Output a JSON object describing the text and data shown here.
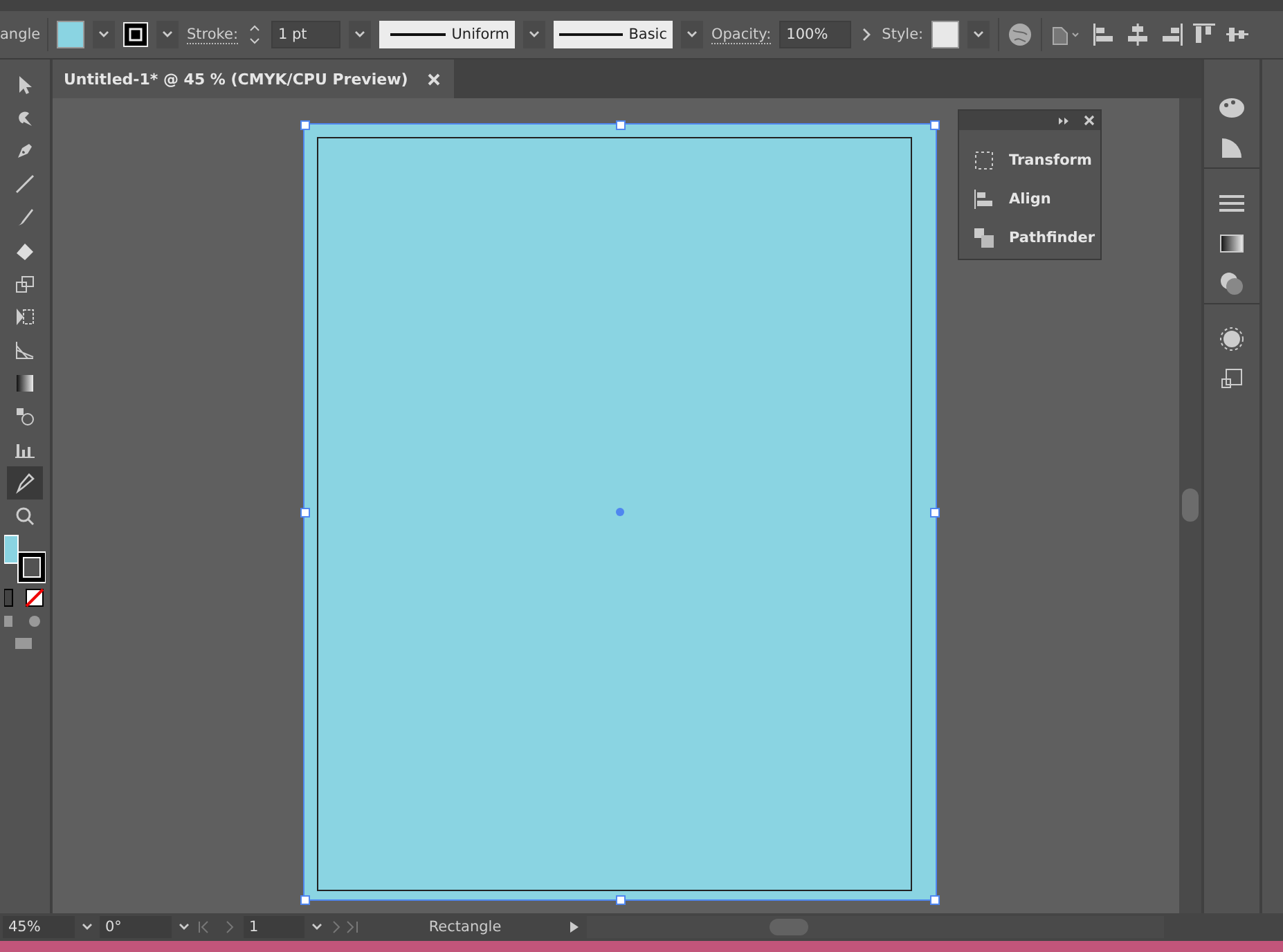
{
  "control_bar": {
    "tool_label": "angle",
    "stroke_label": "Stroke:",
    "stroke_weight": "1 pt",
    "profile": "Uniform",
    "brush": "Basic",
    "opacity_label": "Opacity:",
    "opacity": "100%",
    "style_label": "Style:"
  },
  "document_tab": {
    "title": "Untitled-1* @ 45 % (CMYK/CPU Preview)"
  },
  "tools": [
    {
      "selected": false
    },
    {
      "selected": false
    },
    {
      "selected": false
    },
    {
      "selected": false
    },
    {
      "selected": false
    },
    {
      "selected": false
    },
    {
      "selected": false
    },
    {
      "selected": false
    },
    {
      "selected": false
    },
    {
      "selected": false
    },
    {
      "selected": false
    },
    {
      "selected": false
    },
    {
      "selected": true
    },
    {
      "selected": false
    }
  ],
  "floating_panel": {
    "items": [
      "Transform",
      "Align",
      "Pathfinder"
    ]
  },
  "status_bar": {
    "zoom": "45%",
    "rotation": "0°",
    "artboard_number": "1",
    "current_tool": "Rectangle"
  }
}
